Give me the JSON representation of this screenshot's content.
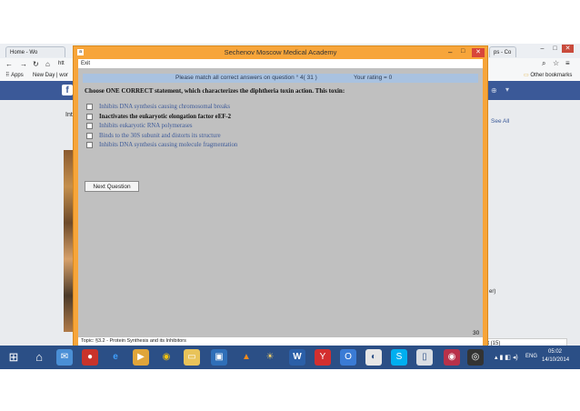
{
  "browser": {
    "tabs": [
      "Home - Wo",
      "ps - Co"
    ],
    "address_fragment": "htt",
    "bookmarks": {
      "apps": "Apps",
      "item": "New Day | wor",
      "other": "Other bookmarks"
    },
    "fb_left_text": "Int",
    "fb_right_link": "See All",
    "fb_side_text": "er)",
    "chat_text": "at (15)"
  },
  "dialog": {
    "title": "Sechenov  Moscow  Medical  Academy",
    "menu_exit": "Exit",
    "question_header": "Please match all correct answers on question ° 4( 31 )",
    "rating": "Your rating  = 0",
    "question": "Choose ONE CORRECT statement, which characterizes the diphtheria toxin action. This toxin:",
    "options": [
      {
        "label": "Inhibits DNA synthesis causing chromosomal breaks",
        "selected": false
      },
      {
        "label": "Inactivates the eukaryotic elongation factor eEF-2",
        "selected": false
      },
      {
        "label": "Inhibits eukaryotic RNA polymerases",
        "selected": false
      },
      {
        "label": "Binds to the 30S subunit and distorts its structure",
        "selected": false
      },
      {
        "label": "Inhibits DNA synthesis causing molecule fragmentation",
        "selected": false
      }
    ],
    "next_button": "Next Question",
    "counter": "30",
    "topic": "Topic:  §3.2 - Protein Synthesis and its Inhibitors"
  },
  "taskbar": {
    "language": "ENG",
    "time": "05:02",
    "date": "14/10/2014",
    "icons": [
      "windows-start-icon",
      "home-icon",
      "mail-icon",
      "app-icon",
      "ie-icon",
      "media-icon",
      "chrome-icon",
      "folder-icon",
      "monitor-icon",
      "vlc-icon",
      "bulb-icon",
      "word-icon",
      "yandex-icon",
      "outlook-icon",
      "disk-icon",
      "skype-icon",
      "window-icon",
      "eye-icon",
      "camera-icon"
    ]
  },
  "colors": {
    "dialog_frame": "#f7a53a",
    "content_bg": "#c0c0c0",
    "question_bar": "#a9c2e0",
    "taskbar": "#2b4f86",
    "facebook": "#3b5998"
  }
}
